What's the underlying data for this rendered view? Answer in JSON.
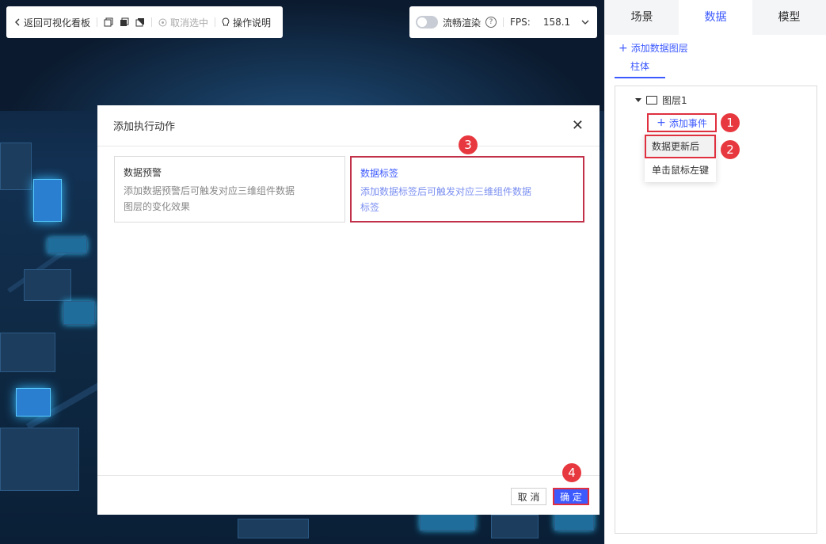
{
  "toolbar": {
    "back_label": "返回可视化看板",
    "cancel_select_label": "取消选中",
    "help_label": "操作说明"
  },
  "render": {
    "smooth_label": "流畅渲染",
    "fps_label": "FPS:",
    "fps_value": "158.1"
  },
  "panel": {
    "tabs": [
      {
        "label": "场景"
      },
      {
        "label": "数据"
      },
      {
        "label": "模型"
      }
    ],
    "add_layer_label": "添加数据图层",
    "subtab_label": "柱体",
    "tree": {
      "layer_label": "图层1",
      "add_event_label": "添加事件",
      "menu": [
        {
          "label": "数据更新后"
        },
        {
          "label": "单击鼠标左键"
        }
      ]
    }
  },
  "dialog": {
    "title": "添加执行动作",
    "cards": [
      {
        "title": "数据预警",
        "desc_line1": "添加数据预警后可触发对应三维组件数据",
        "desc_line2": "图层的变化效果"
      },
      {
        "title": "数据标签",
        "desc_line1": "添加数据标签后可触发对应三维组件数据",
        "desc_line2": "标签"
      }
    ],
    "cancel_label": "取 消",
    "ok_label": "确 定"
  },
  "badges": [
    "1",
    "2",
    "3",
    "4"
  ],
  "colors": {
    "accent": "#3d5afe",
    "highlight_red": "#e0303f",
    "badge_red": "#e8383f"
  }
}
